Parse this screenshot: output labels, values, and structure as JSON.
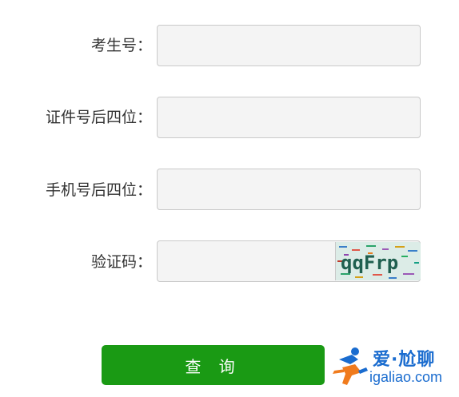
{
  "form": {
    "fields": [
      {
        "label": "考生号：",
        "value": ""
      },
      {
        "label": "证件号后四位：",
        "value": ""
      },
      {
        "label": "手机号后四位：",
        "value": ""
      },
      {
        "label": "验证码：",
        "value": ""
      }
    ],
    "captcha_text": "qqFrp",
    "submit_label": "查 询"
  },
  "watermark": {
    "title": "爱·尬聊",
    "url": "igaliao.com",
    "colors": {
      "blue": "#1a6ccf",
      "orange": "#f07b1d"
    }
  },
  "colors": {
    "button": "#1a9a14",
    "input_bg": "#f4f4f4",
    "border": "#c9c9c9"
  }
}
